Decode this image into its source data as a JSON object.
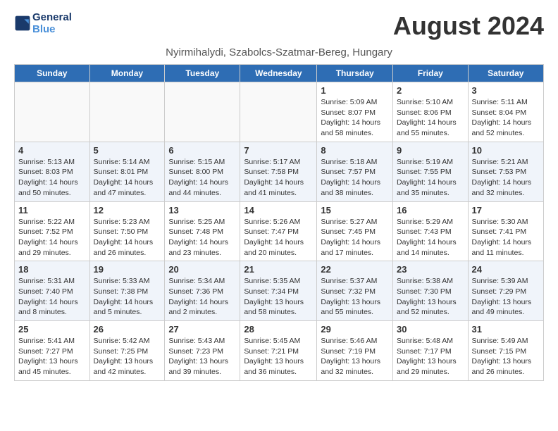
{
  "header": {
    "logo_line1": "General",
    "logo_line2": "Blue",
    "month_title": "August 2024",
    "subtitle": "Nyirmihalydi, Szabolcs-Szatmar-Bereg, Hungary"
  },
  "weekdays": [
    "Sunday",
    "Monday",
    "Tuesday",
    "Wednesday",
    "Thursday",
    "Friday",
    "Saturday"
  ],
  "weeks": [
    [
      {
        "day": "",
        "info": ""
      },
      {
        "day": "",
        "info": ""
      },
      {
        "day": "",
        "info": ""
      },
      {
        "day": "",
        "info": ""
      },
      {
        "day": "1",
        "info": "Sunrise: 5:09 AM\nSunset: 8:07 PM\nDaylight: 14 hours\nand 58 minutes."
      },
      {
        "day": "2",
        "info": "Sunrise: 5:10 AM\nSunset: 8:06 PM\nDaylight: 14 hours\nand 55 minutes."
      },
      {
        "day": "3",
        "info": "Sunrise: 5:11 AM\nSunset: 8:04 PM\nDaylight: 14 hours\nand 52 minutes."
      }
    ],
    [
      {
        "day": "4",
        "info": "Sunrise: 5:13 AM\nSunset: 8:03 PM\nDaylight: 14 hours\nand 50 minutes."
      },
      {
        "day": "5",
        "info": "Sunrise: 5:14 AM\nSunset: 8:01 PM\nDaylight: 14 hours\nand 47 minutes."
      },
      {
        "day": "6",
        "info": "Sunrise: 5:15 AM\nSunset: 8:00 PM\nDaylight: 14 hours\nand 44 minutes."
      },
      {
        "day": "7",
        "info": "Sunrise: 5:17 AM\nSunset: 7:58 PM\nDaylight: 14 hours\nand 41 minutes."
      },
      {
        "day": "8",
        "info": "Sunrise: 5:18 AM\nSunset: 7:57 PM\nDaylight: 14 hours\nand 38 minutes."
      },
      {
        "day": "9",
        "info": "Sunrise: 5:19 AM\nSunset: 7:55 PM\nDaylight: 14 hours\nand 35 minutes."
      },
      {
        "day": "10",
        "info": "Sunrise: 5:21 AM\nSunset: 7:53 PM\nDaylight: 14 hours\nand 32 minutes."
      }
    ],
    [
      {
        "day": "11",
        "info": "Sunrise: 5:22 AM\nSunset: 7:52 PM\nDaylight: 14 hours\nand 29 minutes."
      },
      {
        "day": "12",
        "info": "Sunrise: 5:23 AM\nSunset: 7:50 PM\nDaylight: 14 hours\nand 26 minutes."
      },
      {
        "day": "13",
        "info": "Sunrise: 5:25 AM\nSunset: 7:48 PM\nDaylight: 14 hours\nand 23 minutes."
      },
      {
        "day": "14",
        "info": "Sunrise: 5:26 AM\nSunset: 7:47 PM\nDaylight: 14 hours\nand 20 minutes."
      },
      {
        "day": "15",
        "info": "Sunrise: 5:27 AM\nSunset: 7:45 PM\nDaylight: 14 hours\nand 17 minutes."
      },
      {
        "day": "16",
        "info": "Sunrise: 5:29 AM\nSunset: 7:43 PM\nDaylight: 14 hours\nand 14 minutes."
      },
      {
        "day": "17",
        "info": "Sunrise: 5:30 AM\nSunset: 7:41 PM\nDaylight: 14 hours\nand 11 minutes."
      }
    ],
    [
      {
        "day": "18",
        "info": "Sunrise: 5:31 AM\nSunset: 7:40 PM\nDaylight: 14 hours\nand 8 minutes."
      },
      {
        "day": "19",
        "info": "Sunrise: 5:33 AM\nSunset: 7:38 PM\nDaylight: 14 hours\nand 5 minutes."
      },
      {
        "day": "20",
        "info": "Sunrise: 5:34 AM\nSunset: 7:36 PM\nDaylight: 14 hours\nand 2 minutes."
      },
      {
        "day": "21",
        "info": "Sunrise: 5:35 AM\nSunset: 7:34 PM\nDaylight: 13 hours\nand 58 minutes."
      },
      {
        "day": "22",
        "info": "Sunrise: 5:37 AM\nSunset: 7:32 PM\nDaylight: 13 hours\nand 55 minutes."
      },
      {
        "day": "23",
        "info": "Sunrise: 5:38 AM\nSunset: 7:30 PM\nDaylight: 13 hours\nand 52 minutes."
      },
      {
        "day": "24",
        "info": "Sunrise: 5:39 AM\nSunset: 7:29 PM\nDaylight: 13 hours\nand 49 minutes."
      }
    ],
    [
      {
        "day": "25",
        "info": "Sunrise: 5:41 AM\nSunset: 7:27 PM\nDaylight: 13 hours\nand 45 minutes."
      },
      {
        "day": "26",
        "info": "Sunrise: 5:42 AM\nSunset: 7:25 PM\nDaylight: 13 hours\nand 42 minutes."
      },
      {
        "day": "27",
        "info": "Sunrise: 5:43 AM\nSunset: 7:23 PM\nDaylight: 13 hours\nand 39 minutes."
      },
      {
        "day": "28",
        "info": "Sunrise: 5:45 AM\nSunset: 7:21 PM\nDaylight: 13 hours\nand 36 minutes."
      },
      {
        "day": "29",
        "info": "Sunrise: 5:46 AM\nSunset: 7:19 PM\nDaylight: 13 hours\nand 32 minutes."
      },
      {
        "day": "30",
        "info": "Sunrise: 5:48 AM\nSunset: 7:17 PM\nDaylight: 13 hours\nand 29 minutes."
      },
      {
        "day": "31",
        "info": "Sunrise: 5:49 AM\nSunset: 7:15 PM\nDaylight: 13 hours\nand 26 minutes."
      }
    ]
  ]
}
